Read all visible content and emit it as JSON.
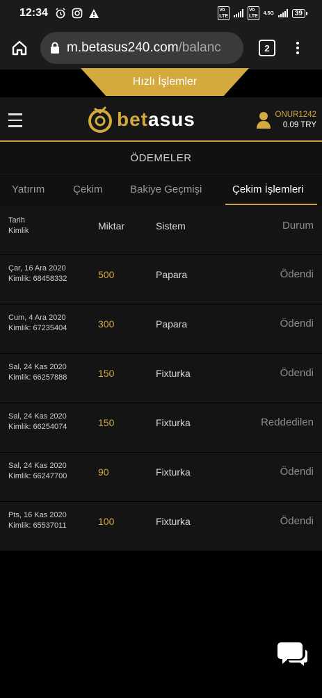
{
  "status_bar": {
    "time": "12:34",
    "network": "4.5G",
    "battery": "39"
  },
  "browser": {
    "url_main": "m.betasus240.com",
    "url_rest": "/balanc",
    "tab_count": "2"
  },
  "quick_actions": {
    "label": "Hızlı İşlemler"
  },
  "header": {
    "logo_bet": "bet",
    "logo_asus": "asus",
    "username": "ONUR1242",
    "balance": "0.09 TRY"
  },
  "section_title": "ÖDEMELER",
  "subtabs": [
    {
      "label": "Yatırım"
    },
    {
      "label": "Çekim"
    },
    {
      "label": "Bakiye Geçmişi"
    },
    {
      "label": "Çekim İşlemleri"
    }
  ],
  "table": {
    "headers": {
      "date": "Tarih",
      "id": "Kimlik",
      "amount": "Miktar",
      "system": "Sistem",
      "status": "Durum"
    },
    "rows": [
      {
        "date": "Çar, 16 Ara 2020",
        "id": "Kimlik: 68458332",
        "amount": "500",
        "system": "Papara",
        "status": "Ödendi"
      },
      {
        "date": "Cum, 4 Ara 2020",
        "id": "Kimlik: 67235404",
        "amount": "300",
        "system": "Papara",
        "status": "Ödendi"
      },
      {
        "date": "Sal, 24 Kas 2020",
        "id": "Kimlik: 66257888",
        "amount": "150",
        "system": "Fixturka",
        "status": "Ödendi"
      },
      {
        "date": "Sal, 24 Kas 2020",
        "id": "Kimlik: 66254074",
        "amount": "150",
        "system": "Fixturka",
        "status": "Reddedilen"
      },
      {
        "date": "Sal, 24 Kas 2020",
        "id": "Kimlik: 66247700",
        "amount": "90",
        "system": "Fixturka",
        "status": "Ödendi"
      },
      {
        "date": "Pts, 16 Kas 2020",
        "id": "Kimlik: 65537011",
        "amount": "100",
        "system": "Fixturka",
        "status": "Ödendi"
      }
    ]
  },
  "colors": {
    "accent": "#d4a93e",
    "background": "#000000",
    "row_background": "#141414"
  }
}
